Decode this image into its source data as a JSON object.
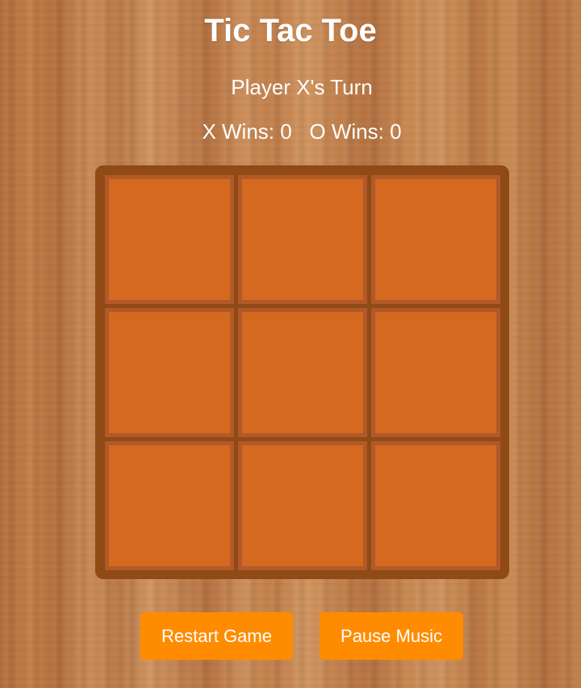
{
  "header": {
    "title": "Tic Tac Toe",
    "status": "Player X's Turn"
  },
  "score": {
    "x_label": "X Wins: ",
    "x_wins": "0",
    "o_label": "O Wins: ",
    "o_wins": "0"
  },
  "board": {
    "cells": [
      "",
      "",
      "",
      "",
      "",
      "",
      "",
      "",
      ""
    ]
  },
  "buttons": {
    "restart_label": "Restart Game",
    "music_label": "Pause Music"
  },
  "colors": {
    "board_frame": "#8f4a16",
    "cell_fill": "#d4691f",
    "cell_border": "#b2592a",
    "button": "#ff8c00"
  }
}
